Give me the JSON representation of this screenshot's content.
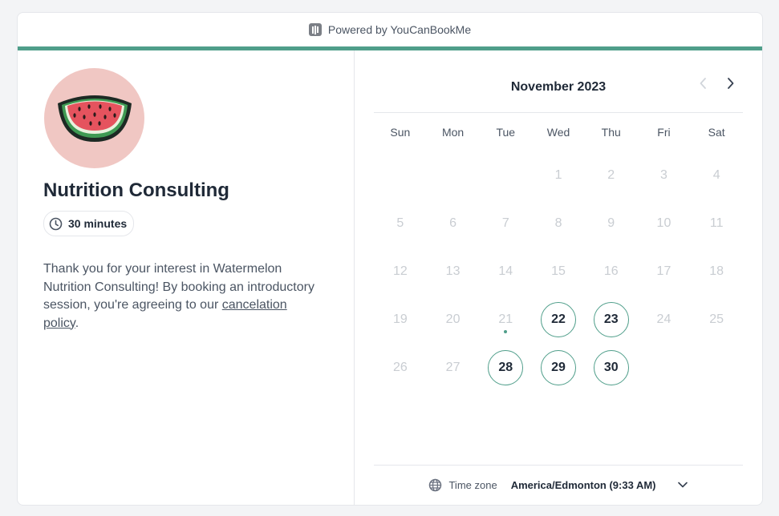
{
  "topbar": {
    "powered_by": "Powered by YouCanBookMe",
    "icon": "youcanbookme-logo-icon"
  },
  "colors": {
    "accent": "#4f9e8a",
    "avatar_bg": "#f0c7c3",
    "muted_day": "#c9cdd2"
  },
  "profile": {
    "avatar_icon": "watermelon-icon",
    "title": "Nutrition Consulting",
    "duration": "30 minutes",
    "duration_icon": "clock-icon",
    "description_before_link": "Thank you for your interest in Watermelon Nutrition Consulting! By booking an introductory session, you're agreeing to our ",
    "link_text": "cancelation policy",
    "description_after_link": "."
  },
  "calendar": {
    "month_label": "November 2023",
    "weekdays": [
      "Sun",
      "Mon",
      "Tue",
      "Wed",
      "Thu",
      "Fri",
      "Sat"
    ],
    "weeks": [
      [
        null,
        null,
        null,
        1,
        2,
        3,
        4
      ],
      [
        5,
        6,
        7,
        8,
        9,
        10,
        11
      ],
      [
        12,
        13,
        14,
        15,
        16,
        17,
        18
      ],
      [
        19,
        20,
        21,
        22,
        23,
        24,
        25
      ],
      [
        26,
        27,
        28,
        29,
        30,
        null,
        null
      ]
    ],
    "available_days": [
      22,
      23,
      28,
      29,
      30
    ],
    "today": 21
  },
  "timezone": {
    "label": "Time zone",
    "value": "America/Edmonton (9:33 AM)"
  }
}
